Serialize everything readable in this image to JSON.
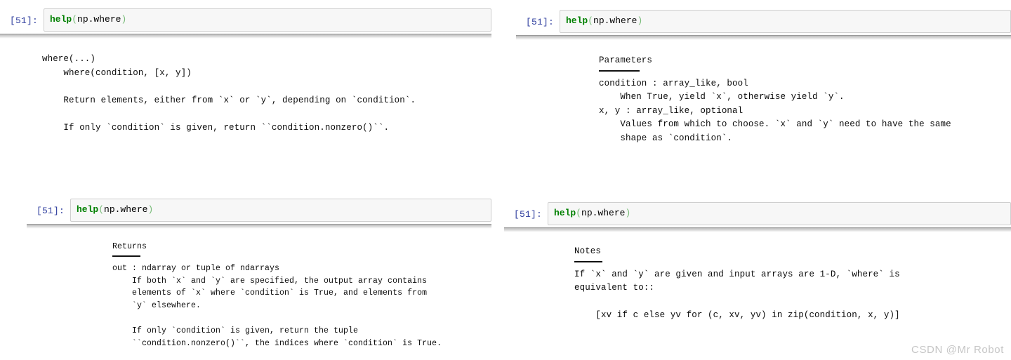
{
  "app": {
    "name": "Jupyter Notebook",
    "watermark": "CSDN @Mr Robot"
  },
  "colors": {
    "prompt": "#303f9f",
    "function_token": "#008000",
    "paren_token": "#77bb77",
    "input_background": "#f7f7f7",
    "input_border": "#cfcfcf",
    "output_text": "#0b0b0b",
    "watermark": "#c6c6c6"
  },
  "panels": [
    {
      "id": "panel-top-left",
      "prompt": "[51]:",
      "input": {
        "code": "help(np.where)",
        "tokens": {
          "fn": "help",
          "open_paren": "(",
          "arg": "np.where",
          "close_paren": ")"
        }
      },
      "output": "where(...)\n    where(condition, [x, y])\n\n    Return elements, either from `x` or `y`, depending on `condition`.\n\n    If only `condition` is given, return ``condition.nonzero()``."
    },
    {
      "id": "panel-top-right",
      "prompt": "[51]:",
      "input": {
        "code": "help(np.where)",
        "tokens": {
          "fn": "help",
          "open_paren": "(",
          "arg": "np.where",
          "close_paren": ")"
        }
      },
      "section_heading": "Parameters",
      "output": "condition : array_like, bool\n    When True, yield `x`, otherwise yield `y`.\nx, y : array_like, optional\n    Values from which to choose. `x` and `y` need to have the same\n    shape as `condition`."
    },
    {
      "id": "panel-bottom-left",
      "prompt": "[51]:",
      "input": {
        "code": "help(np.where)",
        "tokens": {
          "fn": "help",
          "open_paren": "(",
          "arg": "np.where",
          "close_paren": ")"
        }
      },
      "section_heading": "Returns",
      "output": "out : ndarray or tuple of ndarrays\n    If both `x` and `y` are specified, the output array contains\n    elements of `x` where `condition` is True, and elements from\n    `y` elsewhere.\n\n    If only `condition` is given, return the tuple\n    ``condition.nonzero()``, the indices where `condition` is True."
    },
    {
      "id": "panel-bottom-right",
      "prompt": "[51]:",
      "input": {
        "code": "help(np.where)",
        "tokens": {
          "fn": "help",
          "open_paren": "(",
          "arg": "np.where",
          "close_paren": ")"
        }
      },
      "section_heading": "Notes",
      "output": "If `x` and `y` are given and input arrays are 1-D, `where` is\nequivalent to::\n\n    [xv if c else yv for (c, xv, yv) in zip(condition, x, y)]"
    }
  ]
}
